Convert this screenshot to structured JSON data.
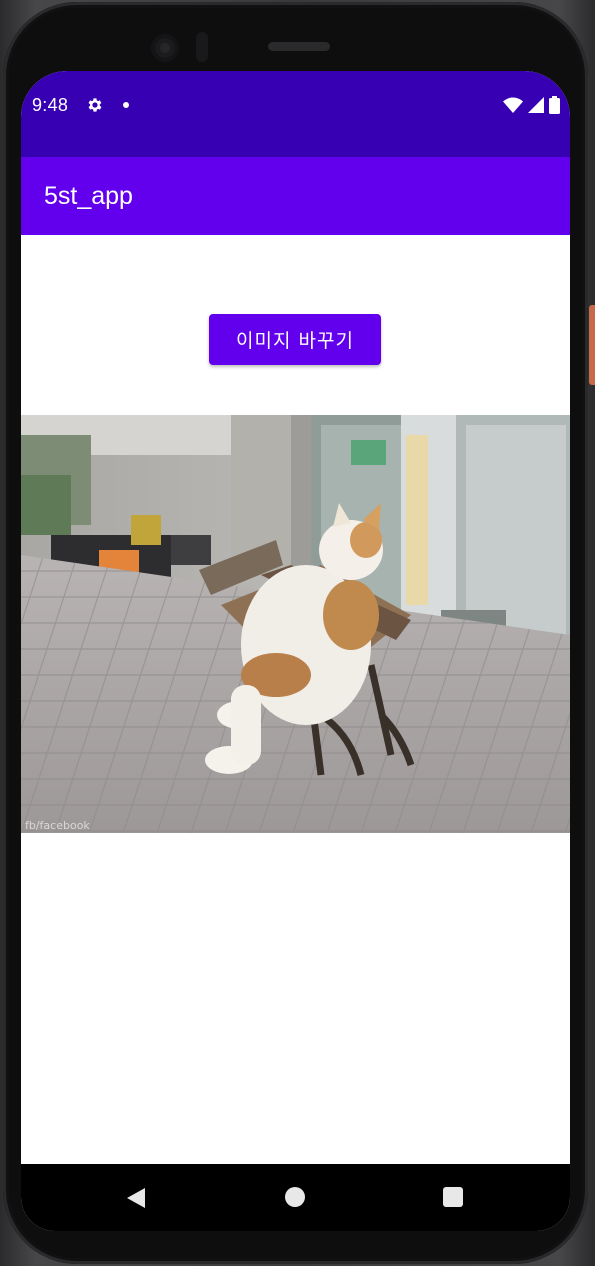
{
  "status_bar": {
    "time": "9:48",
    "icons": [
      "settings-gear-icon",
      "notification-dot-icon",
      "wifi-icon",
      "cellular-signal-icon",
      "battery-icon"
    ]
  },
  "app_bar": {
    "title": "5st_app"
  },
  "main": {
    "change_image_button_label": "이미지 바꾸기",
    "image": {
      "description_icon": "cat-on-bench-photo",
      "watermark": "fb/facebook"
    }
  },
  "nav_bar": {
    "icons": [
      "back-triangle-icon",
      "home-circle-icon",
      "recents-square-icon"
    ]
  },
  "colors": {
    "status_bar": "#3700b3",
    "app_bar": "#6200ee",
    "button": "#6200ee",
    "nav_bar": "#000000",
    "background": "#ffffff"
  }
}
